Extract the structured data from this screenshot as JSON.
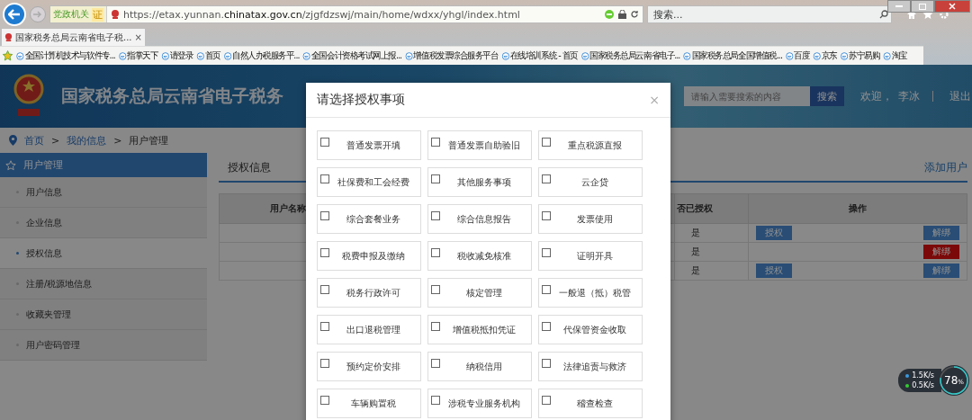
{
  "browser": {
    "address_badge": "党政机关",
    "address_badge_mark": "证",
    "url_prefix": "https://etax.yunnan.",
    "url_domain": "chinatax.gov.cn",
    "url_path": "/zjgfdzswj/main/home/wdxx/yhgl/index.html",
    "search_placeholder": "搜索...",
    "tab_title": "国家税务总局云南省电子税...",
    "tab_close": "×",
    "favorites": [
      "全国计算机技术与软件专...",
      "指掌天下",
      "请登录",
      "首页",
      "自然人办税服务平...",
      "全国会计资格考试网上报...",
      "增值税发票综合服务平台",
      "在线培训系统 - 首页",
      "国家税务总局云南省电子...",
      "国家税务总局全国增值税...",
      "百度",
      "京东",
      "苏宁易购",
      "淘宝"
    ]
  },
  "header": {
    "title": "国家税务总局云南省电子税务",
    "search_placeholder": "请输入需要搜索的内容",
    "search_button": "搜索",
    "welcome": "欢迎，",
    "user": "李冰",
    "logout": "退出"
  },
  "breadcrumb": [
    "首页",
    "我的信息",
    "用户管理"
  ],
  "breadcrumb_separator": ">",
  "sidebar": {
    "title": "用户管理",
    "items": [
      {
        "label": "用户信息",
        "selected": false
      },
      {
        "label": "企业信息",
        "selected": false
      },
      {
        "label": "授权信息",
        "selected": true
      },
      {
        "label": "注册/税源地信息",
        "selected": false
      },
      {
        "label": "收藏夹管理",
        "selected": false
      },
      {
        "label": "用户密码管理",
        "selected": false
      }
    ]
  },
  "main": {
    "tab": "授权信息",
    "add_link": "添加用户",
    "columns": [
      "用户名称",
      "否已授权",
      "操作"
    ],
    "rows": [
      {
        "authorized": "是",
        "grant_button": "授权",
        "unbind": {
          "label": "解绑",
          "selected": false
        }
      },
      {
        "authorized": "是",
        "unbind": {
          "label": "解绑",
          "selected": true
        }
      },
      {
        "authorized": "是",
        "grant_button": "授权",
        "unbind": {
          "label": "解绑",
          "selected": false
        }
      }
    ]
  },
  "modal": {
    "title": "请选择授权事项",
    "close": "×",
    "items": [
      {
        "label": "普通发票开填",
        "checked": false
      },
      {
        "label": "普通发票自助验旧",
        "checked": false
      },
      {
        "label": "重点税源直报",
        "checked": false
      },
      {
        "label": "社保费和工会经费",
        "checked": false
      },
      {
        "label": "其他服务事项",
        "checked": false
      },
      {
        "label": "云企贷",
        "checked": false
      },
      {
        "label": "综合套餐业务",
        "checked": false
      },
      {
        "label": "综合信息报告",
        "checked": false
      },
      {
        "label": "发票使用",
        "checked": false
      },
      {
        "label": "税费申报及缴纳",
        "checked": false
      },
      {
        "label": "税收减免核准",
        "checked": false
      },
      {
        "label": "证明开具",
        "checked": false
      },
      {
        "label": "税务行政许可",
        "checked": false
      },
      {
        "label": "核定管理",
        "checked": false
      },
      {
        "label": "一般退（抵）税管",
        "checked": false
      },
      {
        "label": "出口退税管理",
        "checked": false
      },
      {
        "label": "增值税抵扣凭证",
        "checked": false
      },
      {
        "label": "代保管资金收取",
        "checked": false
      },
      {
        "label": "预约定价安排",
        "checked": false
      },
      {
        "label": "纳税信用",
        "checked": false
      },
      {
        "label": "法律追责与救济",
        "checked": false
      },
      {
        "label": "车辆购置税",
        "checked": false
      },
      {
        "label": "涉税专业服务机构",
        "checked": false
      },
      {
        "label": "稽查检查",
        "checked": false
      }
    ]
  },
  "net_widget": {
    "upload": "1.5",
    "upload_unit": "K/s",
    "download": "0.5",
    "download_unit": "K/s",
    "percent": "78",
    "percent_sign": "%",
    "level": 0.78
  }
}
